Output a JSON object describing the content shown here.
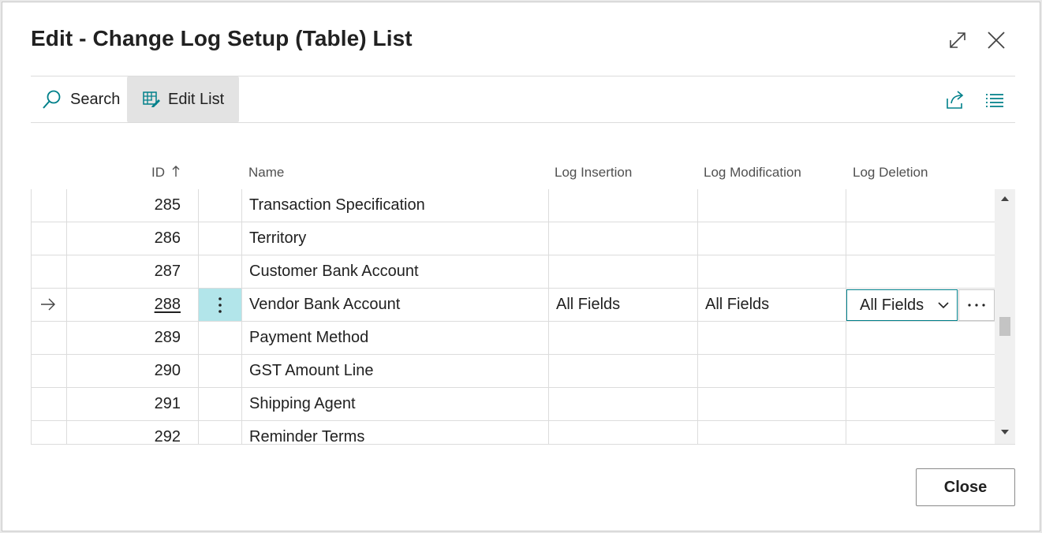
{
  "dialog": {
    "title": "Edit - Change Log Setup (Table) List",
    "close_label": "Close"
  },
  "toolbar": {
    "search_label": "Search",
    "edit_list_label": "Edit List"
  },
  "columns": {
    "id": "ID",
    "name": "Name",
    "log_insertion": "Log Insertion",
    "log_modification": "Log Modification",
    "log_deletion": "Log Deletion"
  },
  "rows": [
    {
      "id": "285",
      "name": "Transaction Specification",
      "log_insertion": "",
      "log_modification": "",
      "log_deletion": ""
    },
    {
      "id": "286",
      "name": "Territory",
      "log_insertion": "",
      "log_modification": "",
      "log_deletion": ""
    },
    {
      "id": "287",
      "name": "Customer Bank Account",
      "log_insertion": "",
      "log_modification": "",
      "log_deletion": ""
    },
    {
      "id": "288",
      "name": "Vendor Bank Account",
      "log_insertion": "All Fields",
      "log_modification": "All Fields",
      "log_deletion": "All Fields"
    },
    {
      "id": "289",
      "name": "Payment Method",
      "log_insertion": "",
      "log_modification": "",
      "log_deletion": ""
    },
    {
      "id": "290",
      "name": "GST Amount Line",
      "log_insertion": "",
      "log_modification": "",
      "log_deletion": ""
    },
    {
      "id": "291",
      "name": "Shipping Agent",
      "log_insertion": "",
      "log_modification": "",
      "log_deletion": ""
    },
    {
      "id": "292",
      "name": "Reminder Terms",
      "log_insertion": "",
      "log_modification": "",
      "log_deletion": ""
    }
  ],
  "selected_row_index": 3,
  "colors": {
    "accent": "#00808a",
    "selected_cell": "#b2e5ea"
  },
  "icons": {
    "expand": "expand-icon",
    "close": "close-icon",
    "search": "search-icon",
    "edit_list": "edit-list-icon",
    "share": "share-icon",
    "list_view": "list-view-icon",
    "sort": "sort-ascending-icon",
    "row_arrow": "current-row-arrow-icon",
    "row_menu": "vertical-ellipsis-icon",
    "dropdown": "chevron-down-icon",
    "more": "horizontal-ellipsis-icon"
  }
}
